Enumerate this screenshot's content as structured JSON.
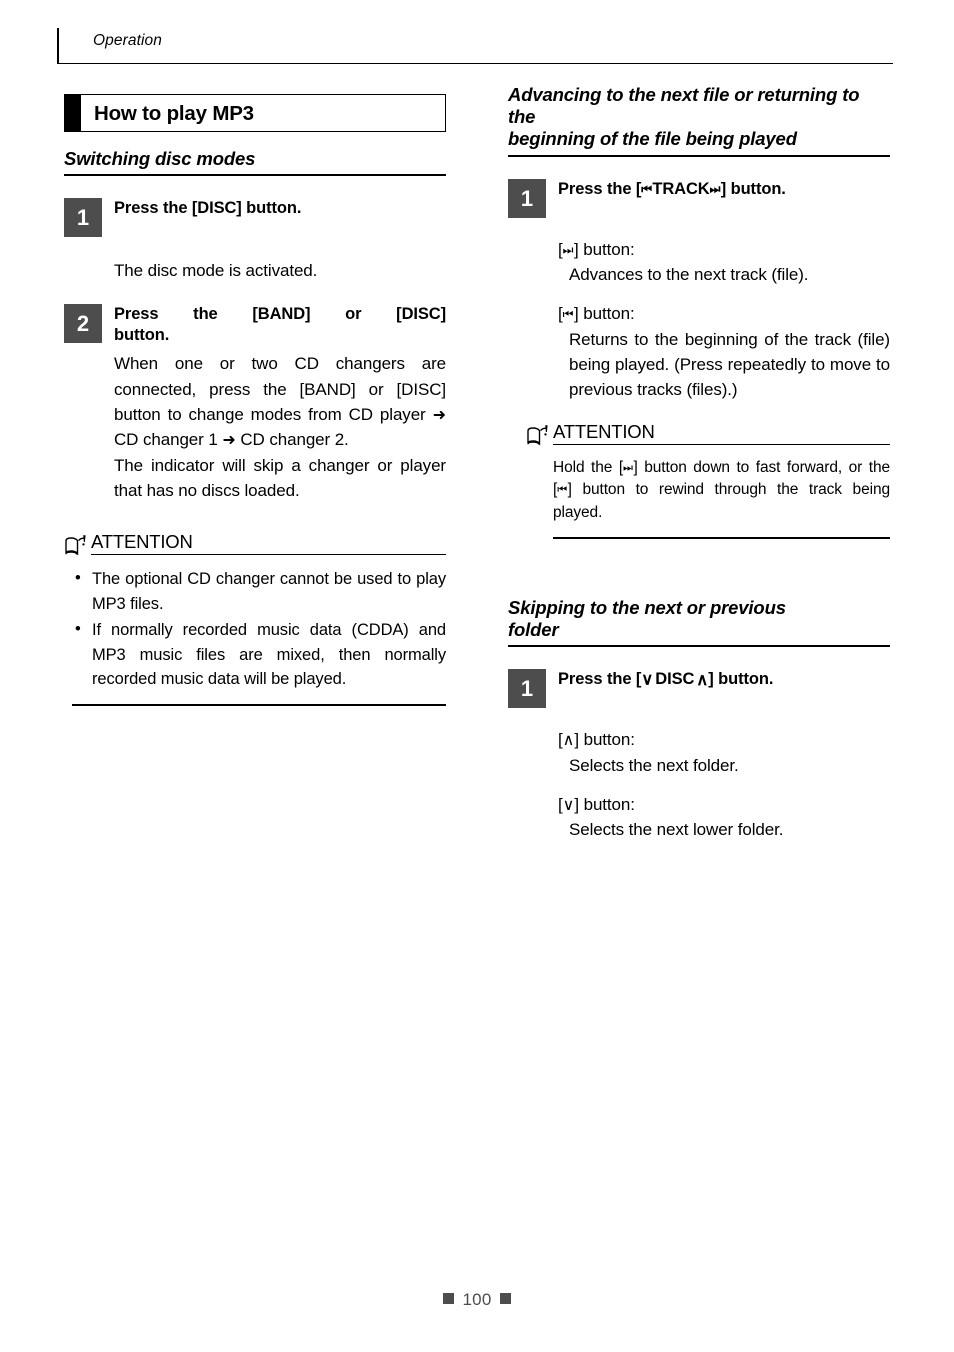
{
  "header": {
    "running_title": "Operation"
  },
  "title_box": {
    "label": "How to play MP3"
  },
  "left_column": {
    "section": {
      "heading": "Switching disc modes"
    },
    "steps": [
      {
        "number": "1",
        "title": "Press the [DISC] button.",
        "body": "The disc mode is activated."
      },
      {
        "number": "2",
        "title_line1": "Press the [BAND] or [DISC]",
        "title_line2": "button.",
        "body_part1": "When one or two CD changers are connected, press the [BAND] or [DISC] button to change modes from CD player ",
        "arrow1": "➜",
        "body_part2": " CD changer 1 ",
        "arrow2": "➜",
        "body_part3": " CD changer 2.",
        "body_part4": "The indicator will skip a changer or player that has no discs loaded."
      }
    ],
    "attention": {
      "icon": "open-book-exclamation-icon",
      "label": "ATTENTION",
      "bullets": [
        "The optional CD changer cannot be used to play MP3 files.",
        "If normally recorded music data (CDDA) and MP3 music files are mixed, then normally recorded music data will be played."
      ],
      "bullet_char": "•"
    }
  },
  "right_column": {
    "section1": {
      "heading_line1": "Advancing to the next file or returning to the",
      "heading_line2": "beginning of the file being played",
      "step": {
        "number": "1",
        "title_before": "Press the [",
        "glyph_prev": "⏮",
        "title_mid": "TRACK",
        "glyph_next": "⏭",
        "title_after": "] button."
      },
      "items": [
        {
          "label_open": "[",
          "glyph": "⏭",
          "label_close": "] button:",
          "text": "Advances to the next track (file)."
        },
        {
          "label_open": "[",
          "glyph": "⏮",
          "label_close": "] button:",
          "text": "Returns to the beginning of the track (file) being played. (Press repeatedly to move to previous tracks (files).)"
        }
      ],
      "attention": {
        "icon": "open-book-exclamation-icon",
        "label": "ATTENTION",
        "text_part1": "Hold the [",
        "glyph_ff": "⏭",
        "text_part2": "] button down to fast forward, or the [",
        "glyph_rw": "⏮",
        "text_part3": "] button to rewind through the track being played."
      }
    },
    "section2": {
      "heading_line1": "Skipping to the next or previous",
      "heading_line2": "folder",
      "step": {
        "number": "1",
        "title_before": "Press the [",
        "glyph_down": "∨",
        "title_mid": "DISC",
        "glyph_up": "∧",
        "title_after": "] button."
      },
      "items": [
        {
          "label_open": "[",
          "glyph": "∧",
          "label_close": "] button:",
          "text": "Selects the next folder."
        },
        {
          "label_open": "[",
          "glyph": "∨",
          "label_close": "] button:",
          "text": "Selects the next lower folder."
        }
      ]
    }
  },
  "footer": {
    "page_number": "100",
    "marker": "■"
  },
  "colors": {
    "step_box": "#4d4d4d",
    "rule": "#000000",
    "footer_text": "#4d4d4d"
  }
}
